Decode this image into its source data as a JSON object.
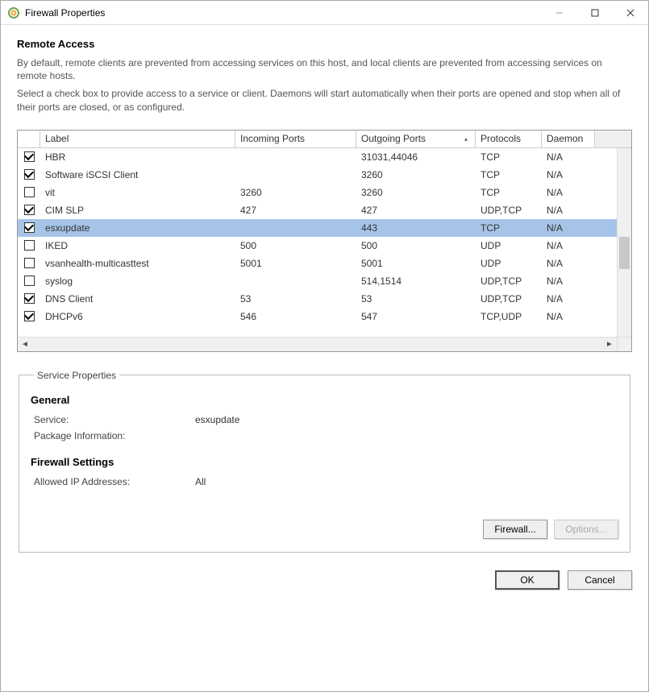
{
  "title": "Firewall Properties",
  "section_heading": "Remote Access",
  "para1": "By default, remote clients are prevented from accessing services on this host, and local clients are prevented from accessing services on remote hosts.",
  "para2": "Select a check box to provide access to a service or client. Daemons will start automatically when their ports are opened and stop when all of their ports are closed, or as configured.",
  "columns": {
    "chk": "",
    "label": "Label",
    "incoming": "Incoming Ports",
    "outgoing": "Outgoing Ports",
    "protocols": "Protocols",
    "daemon": "Daemon"
  },
  "sort_indicator": "▴",
  "rows": [
    {
      "checked": true,
      "label": "HBR",
      "incoming": "",
      "outgoing": "31031,44046",
      "protocols": "TCP",
      "daemon": "N/A",
      "selected": false
    },
    {
      "checked": true,
      "label": "Software iSCSI Client",
      "incoming": "",
      "outgoing": "3260",
      "protocols": "TCP",
      "daemon": "N/A",
      "selected": false
    },
    {
      "checked": false,
      "label": "vit",
      "incoming": "3260",
      "outgoing": "3260",
      "protocols": "TCP",
      "daemon": "N/A",
      "selected": false
    },
    {
      "checked": true,
      "label": "CIM SLP",
      "incoming": "427",
      "outgoing": "427",
      "protocols": "UDP,TCP",
      "daemon": "N/A",
      "selected": false
    },
    {
      "checked": true,
      "label": "esxupdate",
      "incoming": "",
      "outgoing": "443",
      "protocols": "TCP",
      "daemon": "N/A",
      "selected": true
    },
    {
      "checked": false,
      "label": "IKED",
      "incoming": "500",
      "outgoing": "500",
      "protocols": "UDP",
      "daemon": "N/A",
      "selected": false
    },
    {
      "checked": false,
      "label": "vsanhealth-multicasttest",
      "incoming": "5001",
      "outgoing": "5001",
      "protocols": "UDP",
      "daemon": "N/A",
      "selected": false
    },
    {
      "checked": false,
      "label": "syslog",
      "incoming": "",
      "outgoing": "514,1514",
      "protocols": "UDP,TCP",
      "daemon": "N/A",
      "selected": false
    },
    {
      "checked": true,
      "label": "DNS Client",
      "incoming": "53",
      "outgoing": "53",
      "protocols": "UDP,TCP",
      "daemon": "N/A",
      "selected": false
    },
    {
      "checked": true,
      "label": "DHCPv6",
      "incoming": "546",
      "outgoing": "547",
      "protocols": "TCP,UDP",
      "daemon": "N/A",
      "selected": false
    }
  ],
  "service_properties": {
    "legend": "Service Properties",
    "general_heading": "General",
    "service_label": "Service:",
    "service_value": "esxupdate",
    "package_label": "Package Information:",
    "package_value": "",
    "firewall_heading": "Firewall Settings",
    "allowed_label": "Allowed IP Addresses:",
    "allowed_value": "All",
    "firewall_btn": "Firewall...",
    "options_btn": "Options..."
  },
  "dialog_buttons": {
    "ok": "OK",
    "cancel": "Cancel"
  }
}
